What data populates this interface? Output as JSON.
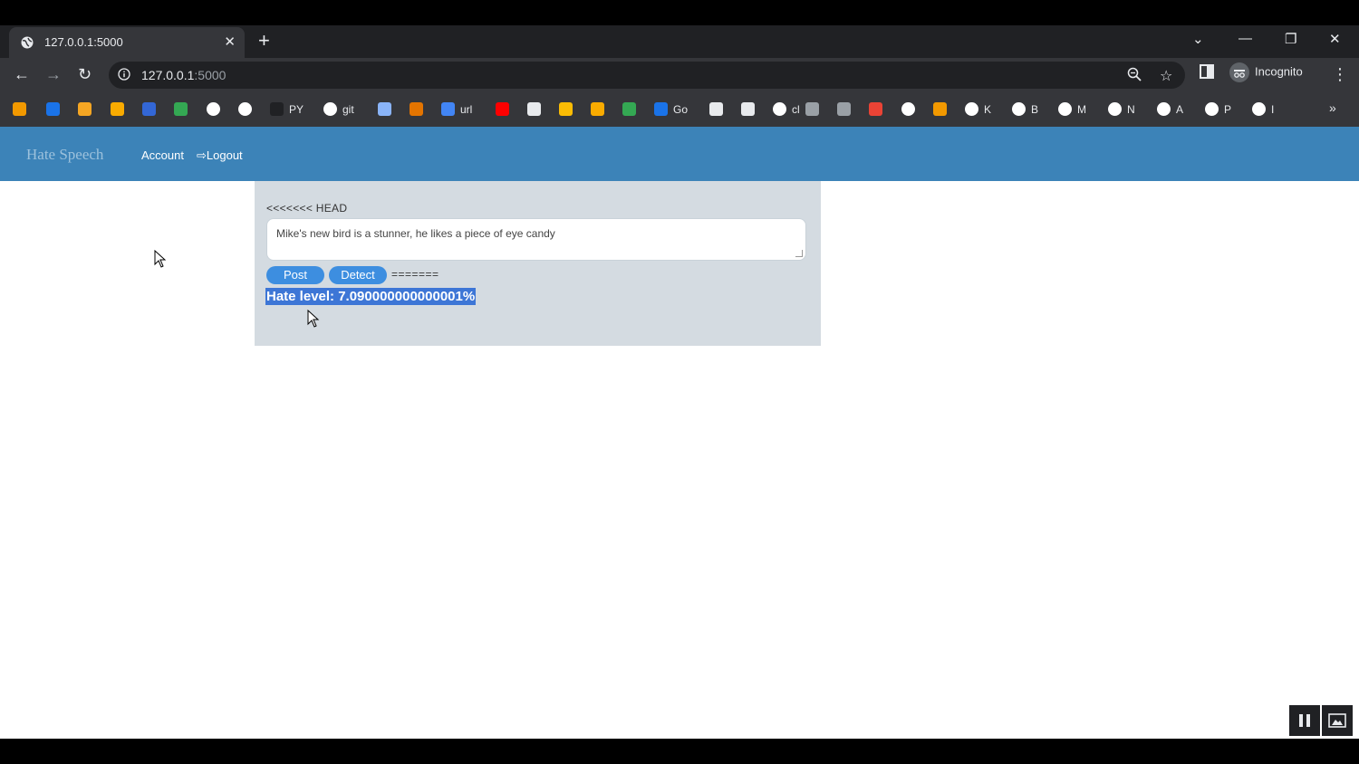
{
  "browser": {
    "tab_title": "127.0.0.1:5000",
    "url_host": "127.0.0.1",
    "url_port": ":5000",
    "profile_label": "Incognito"
  },
  "bookmarks": [
    {
      "color": "#f29900",
      "label": ""
    },
    {
      "color": "#1a73e8",
      "label": ""
    },
    {
      "color": "#f5a623",
      "label": ""
    },
    {
      "color": "#f9ab00",
      "label": ""
    },
    {
      "color": "#3367d6",
      "label": ""
    },
    {
      "color": "#34a853",
      "label": ""
    },
    {
      "color": "#ffffff",
      "label": ""
    },
    {
      "color": "#ffffff",
      "label": ""
    },
    {
      "color": "#202124",
      "label": "PY"
    },
    {
      "color": "#ffffff",
      "label": "git"
    },
    {
      "color": "#8ab4f8",
      "label": ""
    },
    {
      "color": "#e37400",
      "label": ""
    },
    {
      "color": "#4285f4",
      "label": "url"
    },
    {
      "color": "#ff0000",
      "label": ""
    },
    {
      "color": "#e8eaed",
      "label": ""
    },
    {
      "color": "#fbbc04",
      "label": ""
    },
    {
      "color": "#f9ab00",
      "label": ""
    },
    {
      "color": "#34a853",
      "label": ""
    },
    {
      "color": "#1a73e8",
      "label": "Go"
    },
    {
      "color": "#e8eaed",
      "label": ""
    },
    {
      "color": "#e8eaed",
      "label": ""
    },
    {
      "color": "#ffffff",
      "label": "cl"
    },
    {
      "color": "#9aa0a6",
      "label": ""
    },
    {
      "color": "#9aa0a6",
      "label": ""
    },
    {
      "color": "#ea4335",
      "label": ""
    },
    {
      "color": "#ffffff",
      "label": ""
    },
    {
      "color": "#f29900",
      "label": ""
    },
    {
      "color": "#ffffff",
      "label": "K"
    },
    {
      "color": "#ffffff",
      "label": "B"
    },
    {
      "color": "#ffffff",
      "label": "M"
    },
    {
      "color": "#ffffff",
      "label": "N"
    },
    {
      "color": "#ffffff",
      "label": "A"
    },
    {
      "color": "#ffffff",
      "label": "P"
    },
    {
      "color": "#ffffff",
      "label": "I"
    }
  ],
  "navbar": {
    "brand": "Hate Speech",
    "account": "Account",
    "logout": "Logout"
  },
  "panel": {
    "head_marker": "<<<<<<< HEAD",
    "post_text": "Mike's new bird is a stunner, he likes a piece of eye candy",
    "post_button": "Post",
    "detect_button": "Detect",
    "sep_marker": "=======",
    "result": "Hate level: 7.090000000000001%"
  },
  "colors": {
    "navbar_bg": "#3c83b8",
    "panel_bg": "#d4dbe1",
    "button_bg": "#3d8ee0",
    "selection_bg": "#3d76d6"
  }
}
